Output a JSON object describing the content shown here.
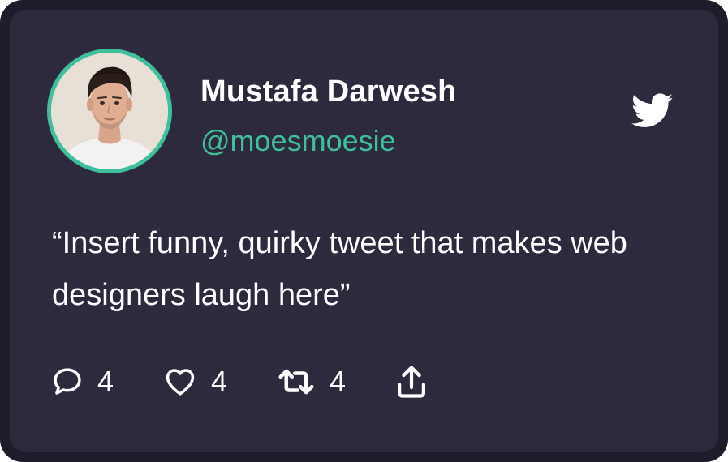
{
  "user": {
    "name": "Mustafa Darwesh",
    "handle": "@moesmoesie"
  },
  "tweet": {
    "text": "“Insert funny, quirky tweet that makes web designers laugh here”"
  },
  "actions": {
    "reply_count": "4",
    "like_count": "4",
    "retweet_count": "4"
  },
  "icons": {
    "reply": "speech-bubble-icon",
    "like": "heart-icon",
    "retweet": "retweet-icon",
    "share": "share-icon",
    "brand": "twitter-bird-icon"
  },
  "colors": {
    "accent": "#3fbf9c",
    "card_background": "#2d2a3e",
    "card_border": "#1e1c2a",
    "text": "#ffffff"
  }
}
